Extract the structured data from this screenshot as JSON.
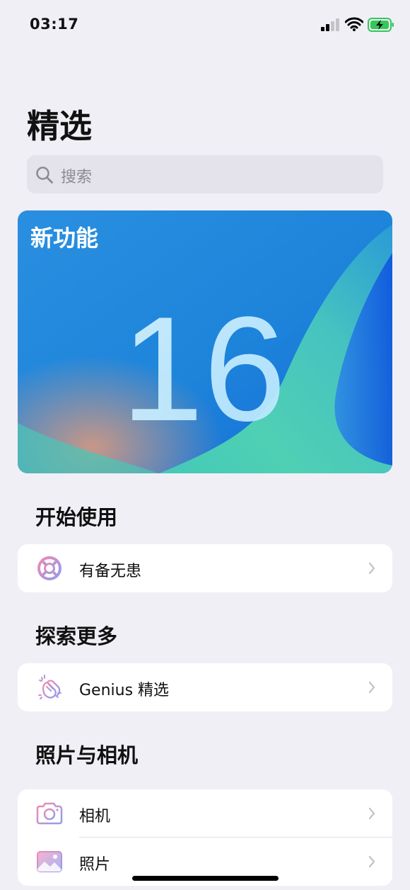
{
  "status_bar": {
    "time": "03:17"
  },
  "page": {
    "title": "精选"
  },
  "search": {
    "placeholder": "搜索"
  },
  "hero": {
    "label": "新功能",
    "number": "16"
  },
  "sections": [
    {
      "title": "开始使用",
      "items": [
        {
          "label": "有备无患",
          "icon": "lifebuoy-icon"
        }
      ]
    },
    {
      "title": "探索更多",
      "items": [
        {
          "label": "Genius 精选",
          "icon": "clapping-hands-icon"
        }
      ]
    },
    {
      "title": "照片与相机",
      "items": [
        {
          "label": "相机",
          "icon": "camera-icon"
        },
        {
          "label": "照片",
          "icon": "photos-icon"
        }
      ]
    }
  ],
  "colors": {
    "background": "#f1eff6",
    "battery": "#34c759",
    "icon_gradient": [
      "#f28ab0",
      "#8f9cf0"
    ]
  }
}
